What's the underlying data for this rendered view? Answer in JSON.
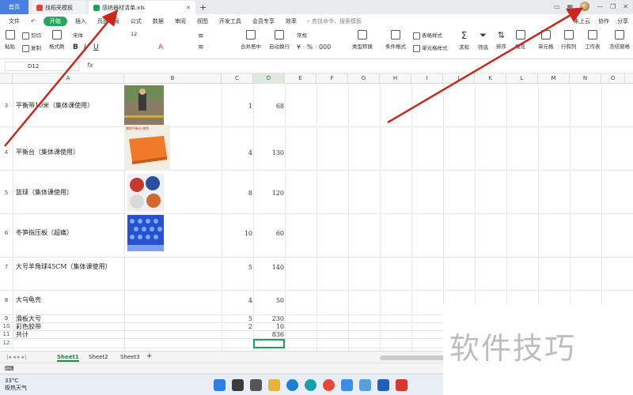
{
  "tabs": {
    "home": "首页",
    "template": "找稻壳模板",
    "file": "感统器材清单.xls"
  },
  "menu": {
    "file": "文件",
    "items": [
      "开始",
      "插入",
      "页面布局",
      "公式",
      "数据",
      "审阅",
      "视图",
      "开发工具",
      "会员专享",
      "效率"
    ],
    "search": "查找命令、搜索模板",
    "cloud": "未上云",
    "collab": "协作",
    "share": "分享"
  },
  "toolbar": {
    "paste": "粘贴",
    "cut": "剪切",
    "copy": "复制",
    "format_painter": "格式刷",
    "font": "宋体",
    "font_size": "12",
    "merge": "合并居中",
    "wrap": "自动换行",
    "number_format": "常规",
    "type_convert": "类型转换",
    "cond_format": "条件格式",
    "cell_style": "单元格样式",
    "table_style": "表格样式",
    "sum": "求和",
    "filter": "筛选",
    "sort": "排序",
    "fill": "填充",
    "cell": "单元格",
    "row_col": "行和列",
    "worksheet": "工作表",
    "freeze": "冻结窗格"
  },
  "formula_bar": {
    "cell_ref": "D12",
    "fx": "fx",
    "value": ""
  },
  "columns": [
    "A",
    "B",
    "C",
    "D",
    "E",
    "F",
    "G",
    "H",
    "I",
    "J",
    "K",
    "L",
    "M",
    "N",
    "O"
  ],
  "rows": [
    {
      "num": "3",
      "name": "平衡带10米（集体课使用）",
      "qty": "1",
      "price": "68"
    },
    {
      "num": "4",
      "name": "平衡台（集体课使用）",
      "qty": "4",
      "price": "130"
    },
    {
      "num": "5",
      "name": "篮球（集体课使用）",
      "qty": "8",
      "price": "120"
    },
    {
      "num": "6",
      "name": "冬笋指压板（超痛）",
      "qty": "10",
      "price": "60"
    },
    {
      "num": "7",
      "name": "大号羊角球45CM（集体课使用）",
      "qty": "5",
      "price": "140"
    },
    {
      "num": "8",
      "name": "大乌龟壳",
      "qty": "4",
      "price": "50"
    },
    {
      "num": "9",
      "name": "滑板大号",
      "qty": "5",
      "price": "230"
    },
    {
      "num": "10",
      "name": "彩色胶带",
      "qty": "2",
      "price": "10"
    },
    {
      "num": "11",
      "name": "共计",
      "qty": "",
      "price": "836"
    },
    {
      "num": "12",
      "name": "",
      "qty": "",
      "price": ""
    }
  ],
  "sheets": [
    "Sheet1",
    "Sheet2",
    "Sheet3"
  ],
  "weather": {
    "temp": "33°C",
    "desc": "极热天气"
  },
  "watermark": "软件技巧",
  "colors": {
    "accent": "#27a55e",
    "arrow": "#c8281e"
  }
}
